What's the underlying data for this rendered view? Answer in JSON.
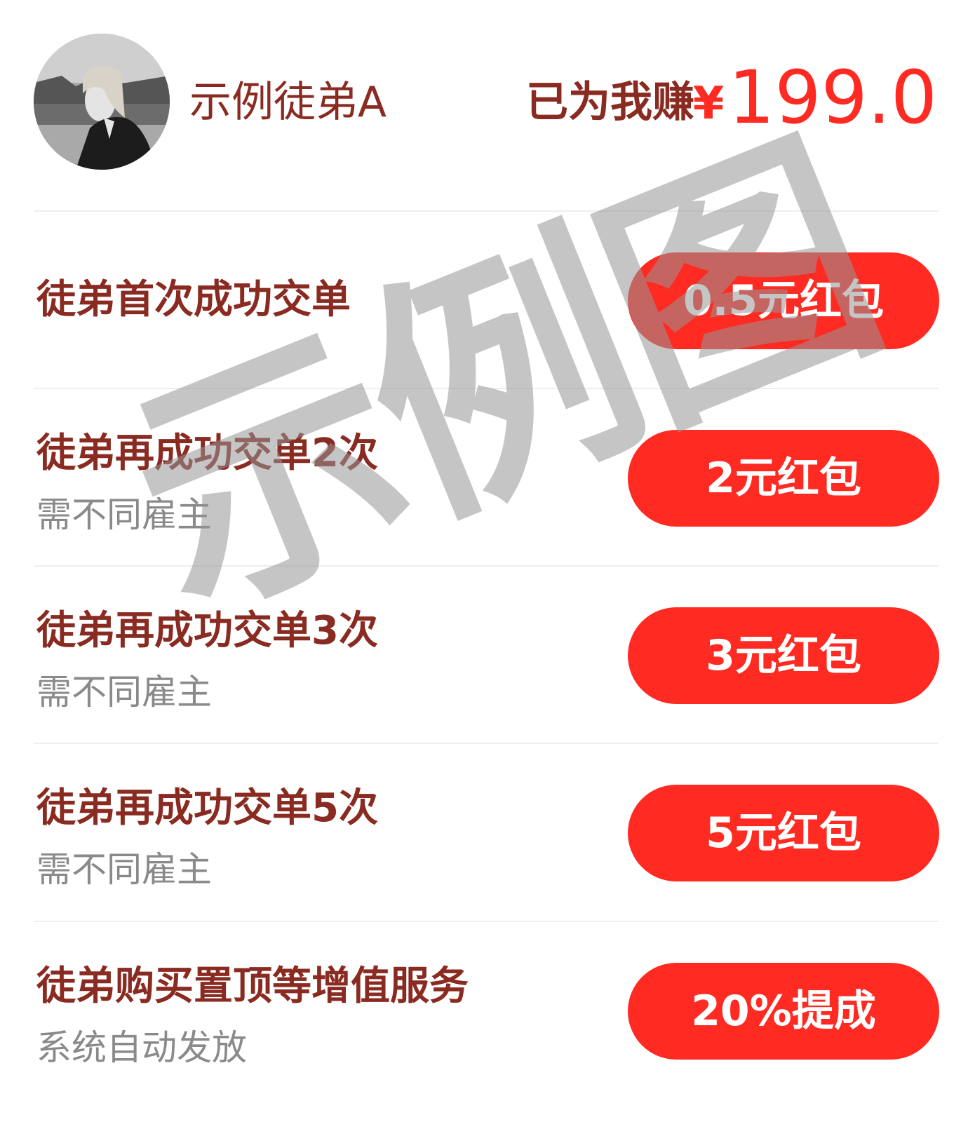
{
  "header": {
    "user_name": "示例徒弟A",
    "earned_label": "已为我赚",
    "currency": "¥",
    "earned_amount": "199.0"
  },
  "rewards": [
    {
      "title": "徒弟首次成功交单",
      "subtitle": "",
      "button": "0.5元红包"
    },
    {
      "title": "徒弟再成功交单2次",
      "subtitle": "需不同雇主",
      "button": "2元红包"
    },
    {
      "title": "徒弟再成功交单3次",
      "subtitle": "需不同雇主",
      "button": "3元红包"
    },
    {
      "title": "徒弟再成功交单5次",
      "subtitle": "需不同雇主",
      "button": "5元红包"
    },
    {
      "title": "徒弟购买置顶等增值服务",
      "subtitle": "系统自动发放",
      "button": "20%提成"
    }
  ],
  "watermark": "示例图",
  "colors": {
    "accent_red": "#ff2a22",
    "title_brown": "#8a2b22",
    "subtitle_gray": "#8a8a8a"
  }
}
